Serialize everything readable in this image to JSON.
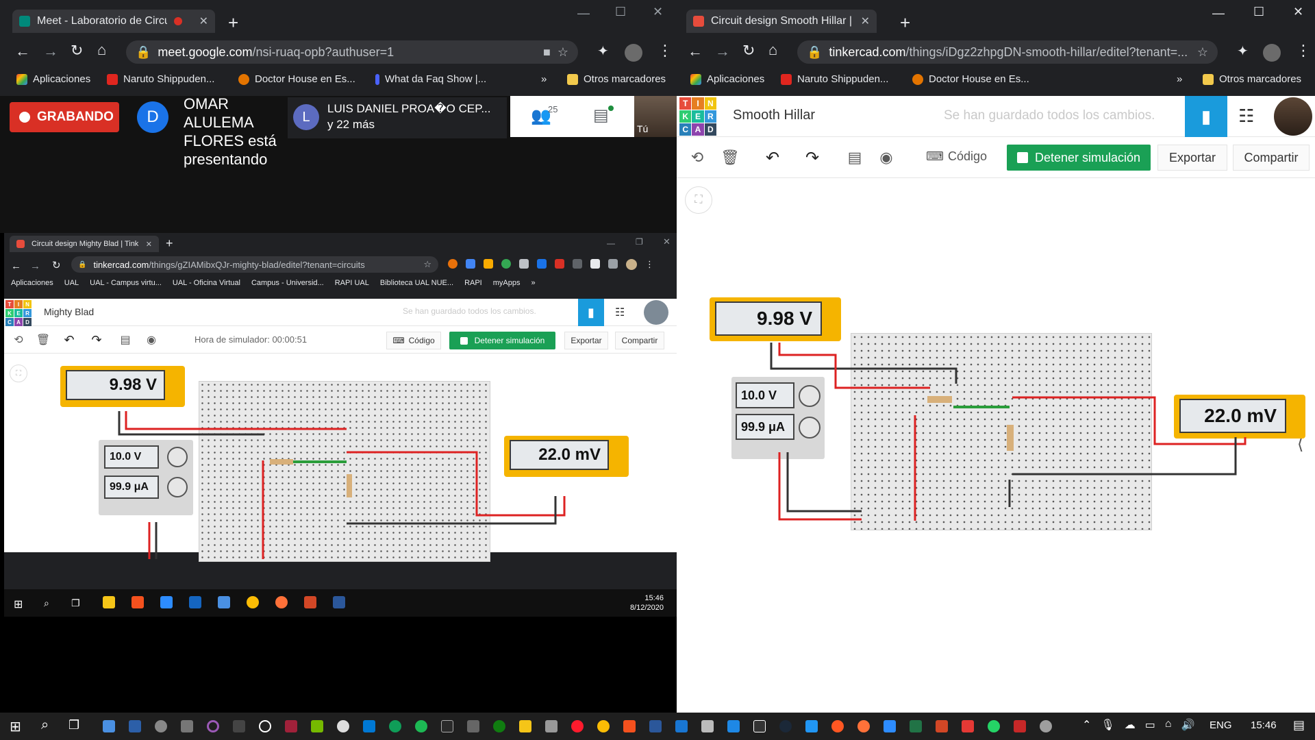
{
  "left_window": {
    "tab_title": "Meet - Laboratorio de Circui",
    "url_host": "meet.google.com",
    "url_path": "/nsi-ruaq-opb?authuser=1",
    "bookmarks": [
      "Aplicaciones",
      "Naruto Shippuden...",
      "Doctor House en Es...",
      "What da Faq Show |...",
      "»",
      "Otros marcadores"
    ],
    "meet": {
      "recording_label": "GRABANDO",
      "presenter_avatar": "D",
      "presenter_text": "OMAR ALULEMA FLORES está presentando",
      "participant_avatar": "L",
      "participant_name": "LUIS DANIEL PROA�O CEP...",
      "participant_more": "y 22 más",
      "people_count": "25",
      "self_label": "Tú"
    }
  },
  "inner_window": {
    "tab_title": "Circuit design Mighty Blad | Tink",
    "url_host": "tinkercad.com",
    "url_path": "/things/gZIAMibxQJr-mighty-blad/editel?tenant=circuits",
    "bookmarks": [
      "Aplicaciones",
      "UAL",
      "UAL - Campus virtu...",
      "UAL - Oficina Virtual",
      "Campus - Universid...",
      "RAPI UAL",
      "Biblioteca UAL NUE...",
      "RAPI",
      "myApps",
      "»"
    ],
    "project_name": "Mighty Blad",
    "save_status": "Se han guardado todos los cambios.",
    "sim_time": "Hora de simulador: 00:00:51",
    "code_label": "Código",
    "stop_sim_label": "Detener simulación",
    "export_label": "Exportar",
    "share_label": "Compartir",
    "voltmeter_value": "9.98 V",
    "mv_meter_value": "22.0 mV",
    "psu_voltage": "10.0 V",
    "psu_current": "99.9 μA",
    "taskbar_time": "15:46",
    "taskbar_date": "8/12/2020"
  },
  "right_window": {
    "tab_title": "Circuit design Smooth Hillar | Tin",
    "url_host": "tinkercad.com",
    "url_path": "/things/iDgz2zhpgDN-smooth-hillar/editel?tenant=...",
    "bookmarks": [
      "Aplicaciones",
      "Naruto Shippuden...",
      "Doctor House en Es...",
      "»",
      "Otros marcadores"
    ],
    "project_name": "Smooth Hillar",
    "save_status": "Se han guardado todos los cambios.",
    "code_label": "Código",
    "stop_sim_label": "Detener simulación",
    "export_label": "Exportar",
    "share_label": "Compartir",
    "voltmeter_value": "9.98 V",
    "mv_meter_value": "22.0 mV",
    "psu_voltage": "10.0 V",
    "psu_current": "99.9 μA"
  },
  "taskbar": {
    "language": "ENG",
    "time": "15:46"
  },
  "colors": {
    "chrome_dark": "#202124",
    "tinkercad_blue": "#1a9bdc",
    "sim_green": "#1aa055",
    "meter_yellow": "#f5b400",
    "recording_red": "#d93025"
  }
}
